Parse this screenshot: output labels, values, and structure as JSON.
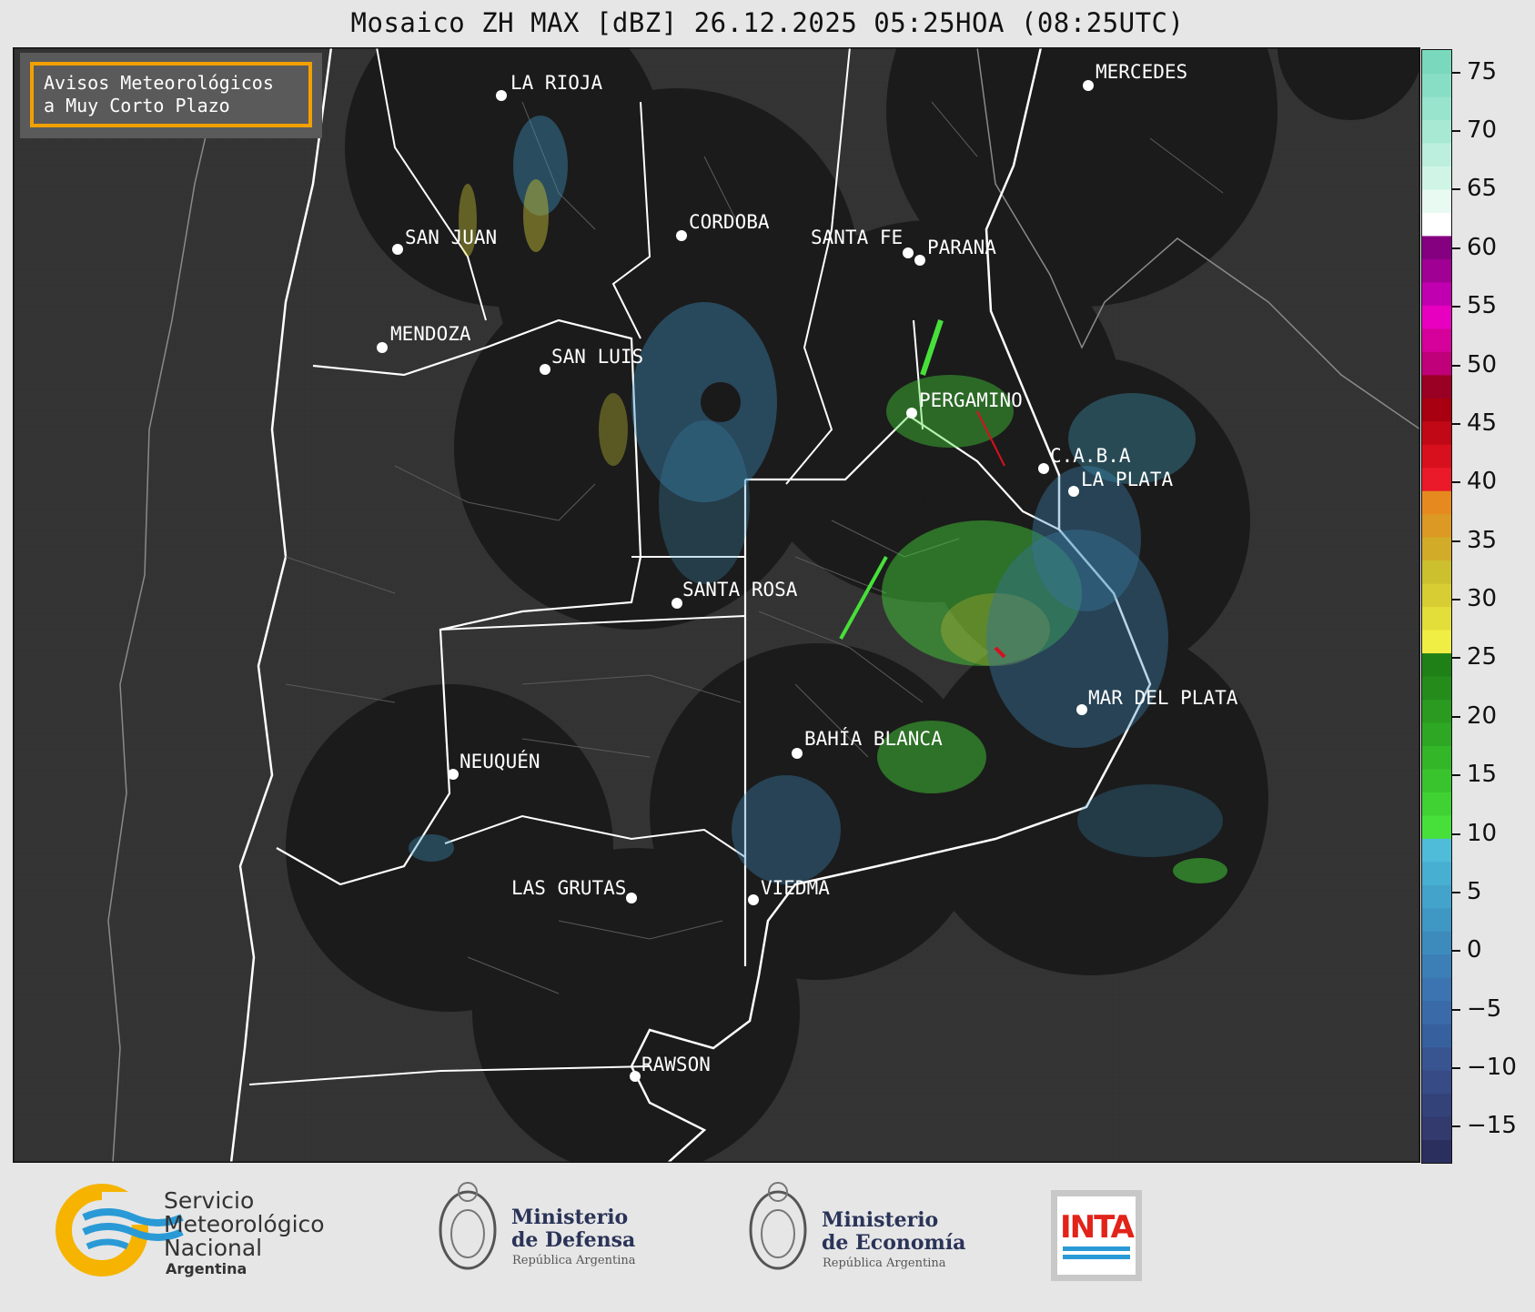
{
  "title": "Mosaico ZH MAX [dBZ] 26.12.2025 05:25HOA (08:25UTC)",
  "badge": {
    "line1": "Avisos Meteorológicos",
    "line2": "a Muy Corto Plazo"
  },
  "cities": [
    {
      "name": "LA RIOJA"
    },
    {
      "name": "SAN JUAN"
    },
    {
      "name": "CORDOBA"
    },
    {
      "name": "SANTA FE"
    },
    {
      "name": "PARANA"
    },
    {
      "name": "MERCEDES"
    },
    {
      "name": "MENDOZA"
    },
    {
      "name": "SAN LUIS"
    },
    {
      "name": "PERGAMINO"
    },
    {
      "name": "C.A.B.A"
    },
    {
      "name": "LA PLATA"
    },
    {
      "name": "SANTA ROSA"
    },
    {
      "name": "MAR DEL PLATA"
    },
    {
      "name": "BAHÍA BLANCA"
    },
    {
      "name": "NEUQUÉN"
    },
    {
      "name": "LAS GRUTAS"
    },
    {
      "name": "VIEDMA"
    },
    {
      "name": "RAWSON"
    }
  ],
  "colorbar": {
    "ticks": [
      "75",
      "70",
      "65",
      "60",
      "55",
      "50",
      "45",
      "40",
      "35",
      "30",
      "25",
      "20",
      "15",
      "10",
      "5",
      "0",
      "−5",
      "−10",
      "−15"
    ],
    "range": [
      -18,
      77
    ],
    "colors": [
      "#2b2f5e",
      "#323a6e",
      "#34427a",
      "#374b86",
      "#385592",
      "#37609e",
      "#3a6aa8",
      "#3b74b0",
      "#3c7fb6",
      "#3d8bbd",
      "#3f97c4",
      "#43a3cb",
      "#47afd2",
      "#4fbcd9",
      "#47e03a",
      "#40d233",
      "#39c42d",
      "#33b628",
      "#2ea824",
      "#2a9a20",
      "#258c1c",
      "#208018",
      "#f0ee44",
      "#e4de3a",
      "#d8ce34",
      "#ccc02e",
      "#d2ac28",
      "#dc9a24",
      "#e68a20",
      "#ea1a2a",
      "#d8101e",
      "#c00816",
      "#a80010",
      "#9a0024",
      "#c0007a",
      "#d6009a",
      "#e800c0",
      "#c000b0",
      "#a00094",
      "#840080",
      "#ffffff",
      "#e8faf2",
      "#d0f5e6",
      "#bcefdd",
      "#a8e9d3",
      "#98e4cc",
      "#88dec4",
      "#7ad9bc"
    ]
  },
  "logos": {
    "smn": {
      "line1": "Servicio",
      "line2": "Meteorológico",
      "line3": "Nacional",
      "line4": "Argentina"
    },
    "defensa": {
      "line1": "Ministerio",
      "line2": "de Defensa",
      "line3": "República Argentina"
    },
    "economia": {
      "line1": "Ministerio",
      "line2": "de Economía",
      "line3": "República Argentina"
    },
    "inta": {
      "text": "INTA"
    }
  }
}
